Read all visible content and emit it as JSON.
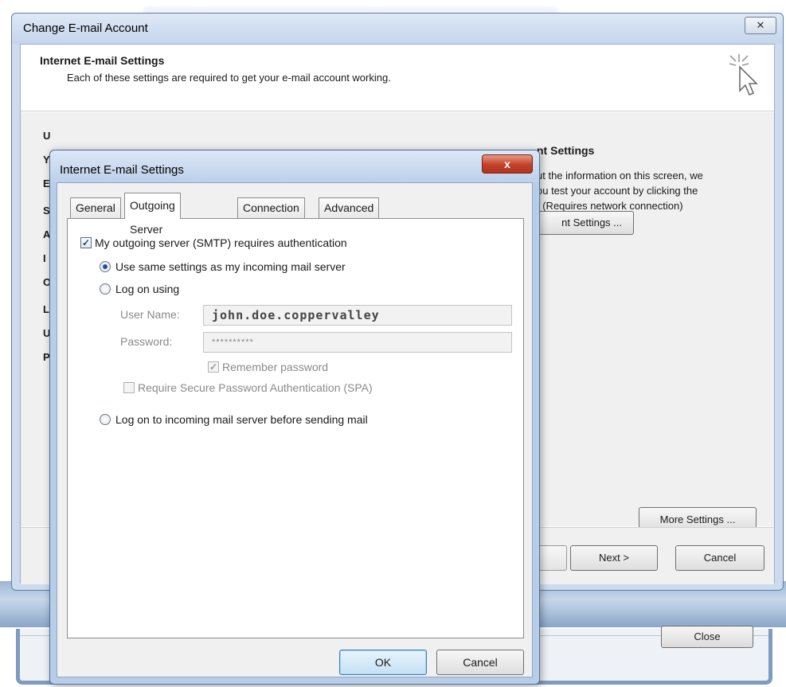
{
  "background": {
    "close_label": "Close"
  },
  "main_dialog": {
    "title": "Change E-mail Account",
    "close_glyph": "✕",
    "header_title": "Internet E-mail Settings",
    "header_subtitle": "Each of these settings are required to get your e-mail account working.",
    "header_icon": "cursor-sparkle-icon",
    "left_letters": [
      "U",
      "Y",
      "E",
      "S",
      "A",
      "I",
      "O",
      "L",
      "U",
      "P"
    ],
    "test_title": "nt Settings",
    "test_desc_lines": [
      "ut the information on this screen, we",
      "ou test your account by clicking the",
      ". (Requires network connection)"
    ],
    "test_button": "nt Settings ...",
    "more_settings": "More Settings ...",
    "next_button": "Next >",
    "cancel_button": "Cancel"
  },
  "settings_dialog": {
    "title": "Internet E-mail Settings",
    "close_glyph": "x",
    "tabs": [
      "General",
      "Outgoing Server",
      "Connection",
      "Advanced"
    ],
    "active_tab": "Outgoing Server",
    "smtp_auth_label": "My outgoing server (SMTP) requires authentication",
    "smtp_auth_checked": true,
    "same_settings_label": "Use same settings as my incoming mail server",
    "log_on_using_label": "Log on using",
    "user_name_label": "User Name:",
    "user_name_value": "john.doe.coppervalley",
    "password_label": "Password:",
    "password_value": "**********",
    "remember_password_label": "Remember password",
    "spa_label": "Require Secure Password Authentication (SPA)",
    "log_on_incoming_label": "Log on to incoming mail server before sending mail",
    "ok_button": "OK",
    "cancel_button": "Cancel"
  }
}
